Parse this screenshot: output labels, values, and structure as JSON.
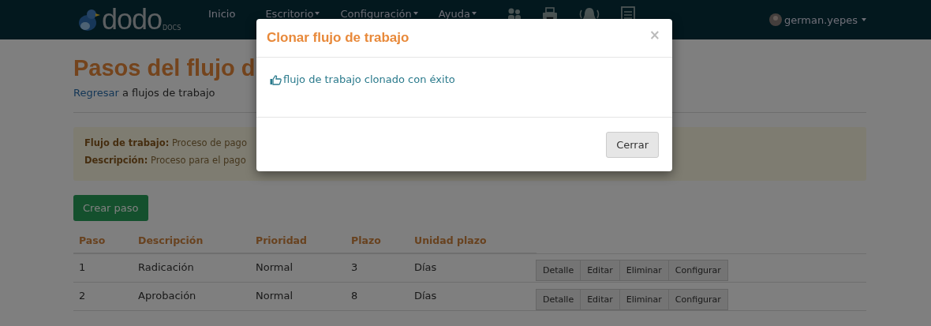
{
  "navbar": {
    "logo": {
      "text": "dodo",
      "sub": "DOCS"
    },
    "menu": [
      {
        "label": "Inicio",
        "dropdown": false
      },
      {
        "label": "Escritorio",
        "dropdown": true
      },
      {
        "label": "Configuración",
        "dropdown": true
      },
      {
        "label": "Ayuda",
        "dropdown": true
      }
    ],
    "icons": [
      {
        "kind": "people"
      },
      {
        "kind": "printer"
      },
      {
        "kind": "bell"
      },
      {
        "kind": "document"
      }
    ],
    "user": {
      "name": "german.yepes",
      "dropdown": true
    }
  },
  "page": {
    "title": "Pasos del flujo d",
    "back": {
      "link": "Regresar",
      "text": "a flujos de trabajo"
    },
    "info": [
      {
        "label": "Flujo de trabajo:",
        "value": "Proceso de pago"
      },
      {
        "label": "Descripción:",
        "value": "Proceso para el pago"
      }
    ],
    "create_button": "Crear paso",
    "table": {
      "columns": [
        "Paso",
        "Descripción",
        "Prioridad",
        "Plazo",
        "Unidad plazo"
      ],
      "rows": [
        {
          "cells": [
            "1",
            "Radicación",
            "Normal",
            "3",
            "Días"
          ],
          "actions": [
            "Detalle",
            "Editar",
            "Eliminar",
            "Configurar"
          ]
        },
        {
          "cells": [
            "2",
            "Aprobación",
            "Normal",
            "8",
            "Días"
          ],
          "actions": [
            "Detalle",
            "Editar",
            "Eliminar",
            "Configurar"
          ]
        }
      ]
    }
  },
  "modal": {
    "open": true,
    "title": "Clonar flujo de trabajo",
    "close": "×",
    "message": "flujo de trabajo clonado con éxito",
    "button": "Cerrar"
  }
}
